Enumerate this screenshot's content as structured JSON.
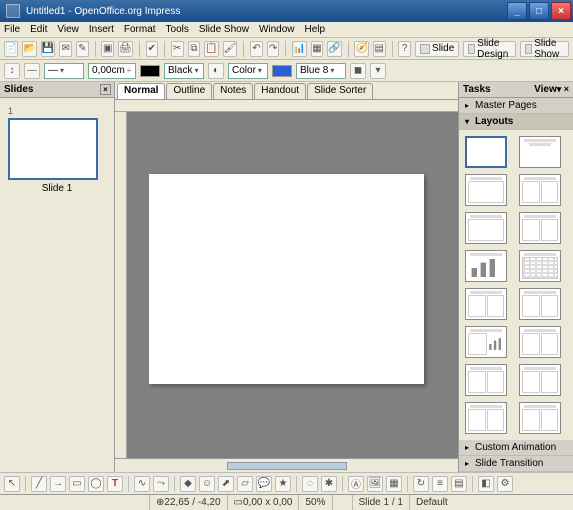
{
  "title": "Untitled1 - OpenOffice.org Impress",
  "menu": [
    "File",
    "Edit",
    "View",
    "Insert",
    "Format",
    "Tools",
    "Slide Show",
    "Window",
    "Help"
  ],
  "format_bar": {
    "size_value": "0,00cm",
    "color_label": "Black",
    "color_label2": "Color",
    "color_value": "Blue 8"
  },
  "slide_toolbar": {
    "slide_btn": "Slide",
    "design_btn": "Slide Design",
    "show_btn": "Slide Show"
  },
  "panes": {
    "slides_title": "Slides",
    "slide1_label": "Slide 1",
    "tasks_title": "Tasks",
    "tasks_view": "View"
  },
  "view_tabs": [
    "Normal",
    "Outline",
    "Notes",
    "Handout",
    "Slide Sorter"
  ],
  "task_sections": {
    "master": "Master Pages",
    "layouts": "Layouts",
    "custom_anim": "Custom Animation",
    "transition": "Slide Transition"
  },
  "status": {
    "pos": "22,65 / -4,20",
    "size": "0,00 x 0,00",
    "zoom": "50%",
    "slide_counter": "Slide 1 / 1",
    "mode": "Default"
  }
}
